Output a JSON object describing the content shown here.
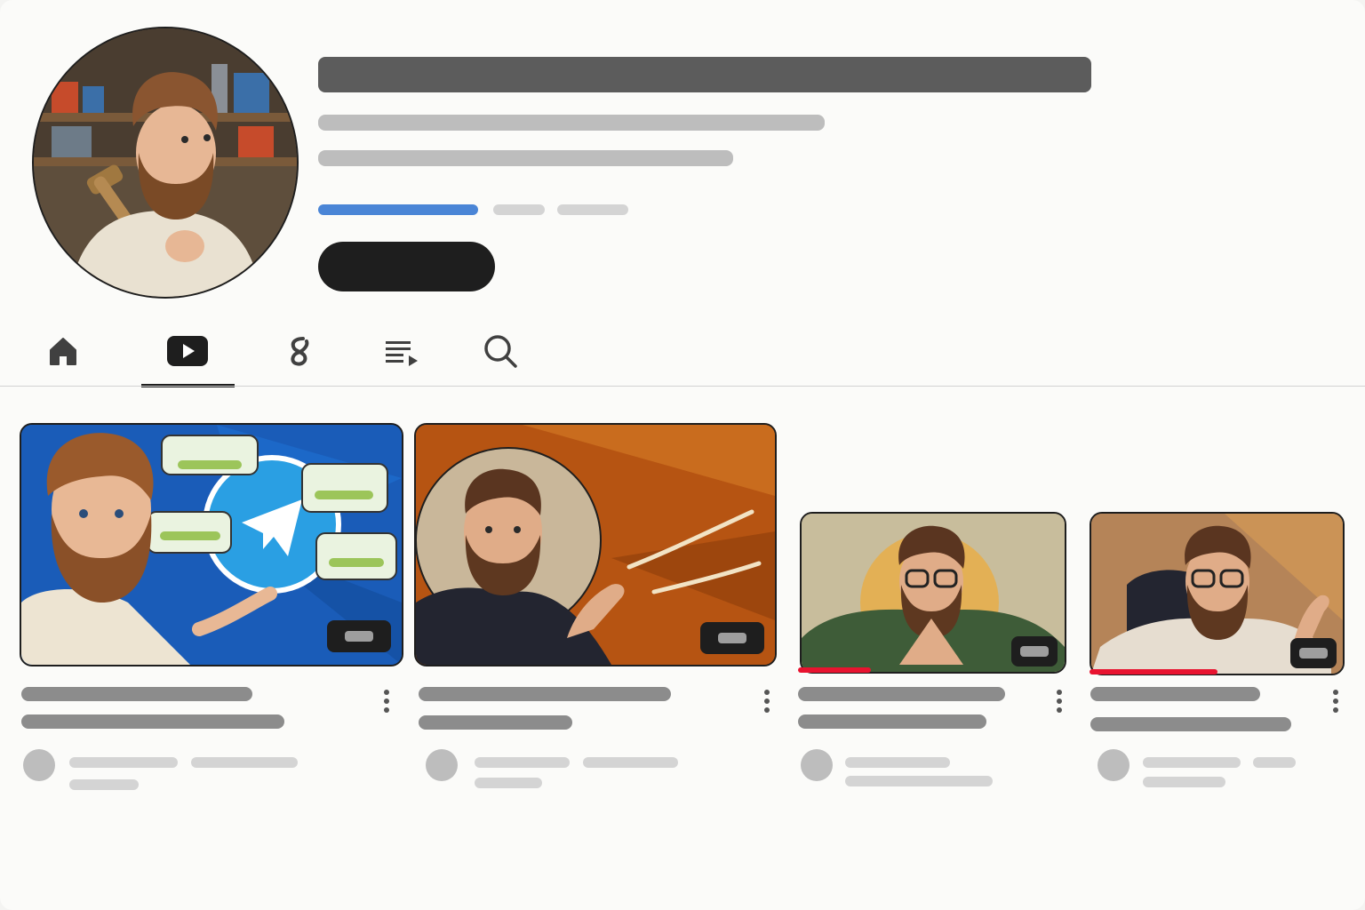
{
  "profile": {
    "avatar_icon": "profile-avatar-illustration",
    "subscribe_label": ""
  },
  "tabs": [
    {
      "icon": "home-icon"
    },
    {
      "icon": "videos-icon",
      "selected": true
    },
    {
      "icon": "shorts-icon"
    },
    {
      "icon": "playlists-icon"
    },
    {
      "icon": "search-icon"
    }
  ],
  "videos": [
    {
      "thumb_icon": "telegram-video-thumbnail",
      "watched_fraction": 0
    },
    {
      "thumb_icon": "speaking-presenter-thumbnail",
      "watched_fraction": 0
    },
    {
      "thumb_icon": "thinking-presenter-thumbnail",
      "watched_fraction": 0.28
    },
    {
      "thumb_icon": "explaining-presenter-thumbnail",
      "watched_fraction": 0.5
    }
  ],
  "colors": {
    "accent_blue": "#4a85d6",
    "progress_red": "#e8132f",
    "button_dark": "#1e1e1e"
  }
}
